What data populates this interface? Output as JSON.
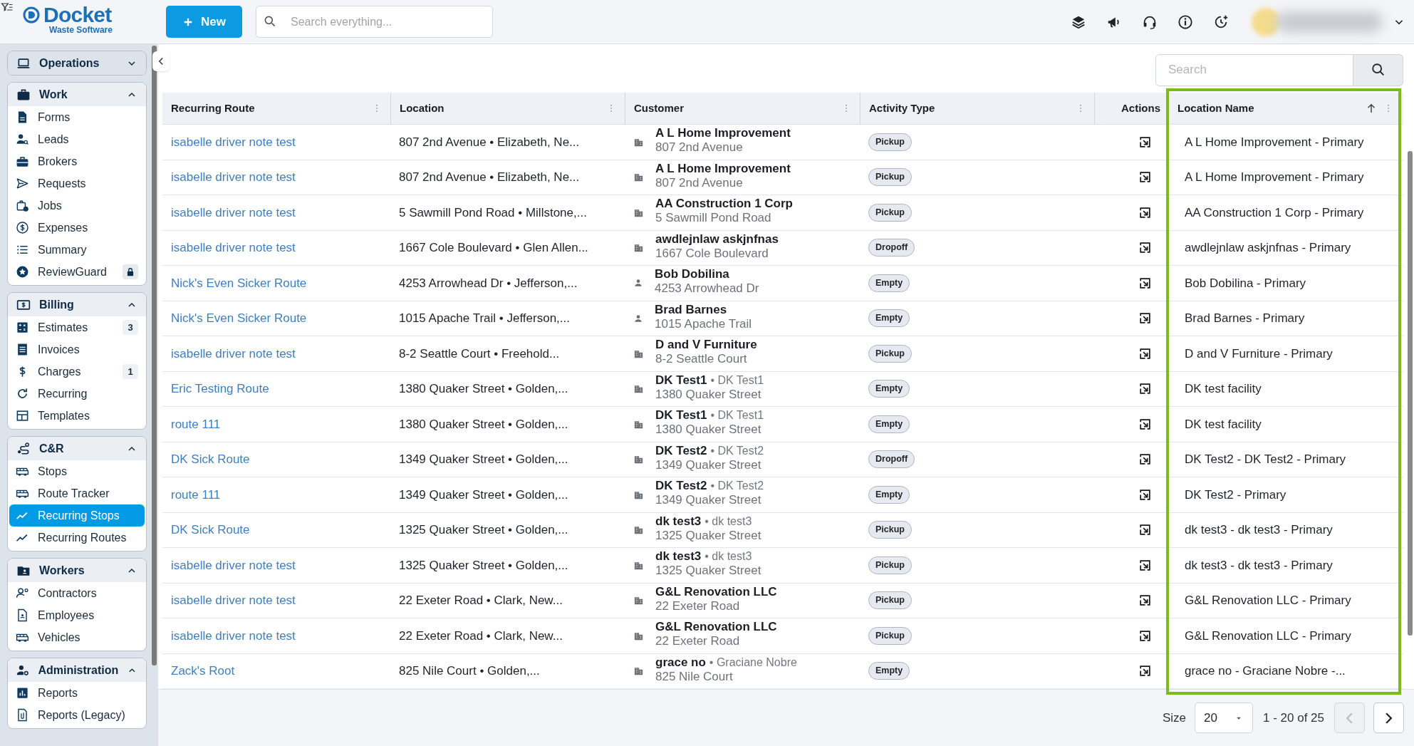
{
  "topbar": {
    "logo_name": "Docket",
    "logo_tagline": "Waste Software",
    "new_button": "New",
    "search": {
      "placeholder": "Search everything..."
    }
  },
  "sidebar": {
    "sections": [
      {
        "title": "Operations",
        "expanded": false
      },
      {
        "title": "Work",
        "expanded": true,
        "items": [
          {
            "label": "Forms",
            "selected": false,
            "locked": false
          },
          {
            "label": "Leads",
            "selected": false,
            "locked": false
          },
          {
            "label": "Brokers",
            "selected": false,
            "locked": false
          },
          {
            "label": "Requests",
            "selected": false,
            "locked": false
          },
          {
            "label": "Jobs",
            "selected": false,
            "locked": false
          },
          {
            "label": "Expenses",
            "selected": false,
            "locked": false
          },
          {
            "label": "Summary",
            "selected": false,
            "locked": false
          },
          {
            "label": "ReviewGuard",
            "selected": false,
            "locked": true
          }
        ]
      },
      {
        "title": "Billing",
        "expanded": true,
        "items": [
          {
            "label": "Estimates",
            "selected": false,
            "badge": "3"
          },
          {
            "label": "Invoices",
            "selected": false
          },
          {
            "label": "Charges",
            "selected": false,
            "badge": "1"
          },
          {
            "label": "Recurring",
            "selected": false
          },
          {
            "label": "Templates",
            "selected": false
          }
        ]
      },
      {
        "title": "C&R",
        "expanded": true,
        "items": [
          {
            "label": "Stops",
            "selected": false
          },
          {
            "label": "Route Tracker",
            "selected": false
          },
          {
            "label": "Recurring Stops",
            "selected": true
          },
          {
            "label": "Recurring Routes",
            "selected": false
          }
        ]
      },
      {
        "title": "Workers",
        "expanded": true,
        "items": [
          {
            "label": "Contractors",
            "selected": false
          },
          {
            "label": "Employees",
            "selected": false
          },
          {
            "label": "Vehicles",
            "selected": false
          }
        ]
      },
      {
        "title": "Administration",
        "expanded": true,
        "items": [
          {
            "label": "Reports",
            "selected": false
          },
          {
            "label": "Reports (Legacy)",
            "selected": false
          }
        ]
      }
    ]
  },
  "table_search": {
    "placeholder": "Search"
  },
  "table": {
    "columns": [
      {
        "label": "Recurring Route",
        "sorted": false,
        "highlighted": false
      },
      {
        "label": "Location",
        "sorted": false,
        "highlighted": false
      },
      {
        "label": "Customer",
        "sorted": false,
        "highlighted": false
      },
      {
        "label": "Activity Type",
        "sorted": false,
        "highlighted": false
      },
      {
        "label": "Actions",
        "sorted": false,
        "highlighted": false
      },
      {
        "label": "Location Name",
        "sorted": true,
        "highlighted": true
      }
    ],
    "rows": [
      {
        "route": "isabelle driver note test",
        "location": "807 2nd Avenue • Elizabeth, Ne...",
        "kind": "business",
        "customer": "A L Home Improvement",
        "address": "807 2nd Avenue",
        "activity": "Pickup",
        "location_name": "A L Home Improvement - Primary"
      },
      {
        "route": "isabelle driver note test",
        "location": "807 2nd Avenue • Elizabeth, Ne...",
        "kind": "business",
        "customer": "A L Home Improvement",
        "address": "807 2nd Avenue",
        "activity": "Pickup",
        "location_name": "A L Home Improvement - Primary"
      },
      {
        "route": "isabelle driver note test",
        "location": "5 Sawmill Pond Road • Millstone,...",
        "kind": "business",
        "customer": "AA Construction 1 Corp",
        "address": "5 Sawmill Pond Road",
        "activity": "Pickup",
        "location_name": "AA Construction 1 Corp - Primary"
      },
      {
        "route": "isabelle driver note test",
        "location": "1667 Cole Boulevard • Glen Allen...",
        "kind": "business",
        "customer": "awdlejnlaw askjnfnas",
        "address": "1667 Cole Boulevard",
        "activity": "Dropoff",
        "location_name": "awdlejnlaw askjnfnas - Primary"
      },
      {
        "route": "Nick's Even Sicker Route",
        "location": "4253 Arrowhead Dr • Jefferson,...",
        "kind": "person",
        "customer": "Bob Dobilina",
        "address": "4253 Arrowhead Dr",
        "activity": "Empty",
        "location_name": "Bob Dobilina - Primary"
      },
      {
        "route": "Nick's Even Sicker Route",
        "location": "1015 Apache Trail • Jefferson,...",
        "kind": "person",
        "customer": "Brad Barnes",
        "address": "1015 Apache Trail",
        "activity": "Empty",
        "location_name": "Brad Barnes - Primary"
      },
      {
        "route": "isabelle driver note test",
        "location": "8-2 Seattle Court • Freehold...",
        "kind": "business",
        "customer": "D and V Furniture",
        "address": "8-2 Seattle Court",
        "activity": "Pickup",
        "location_name": "D and V Furniture - Primary"
      },
      {
        "route": "Eric Testing Route",
        "location": "1380 Quaker Street • Golden,...",
        "kind": "business",
        "customer": "DK Test1",
        "customer_alias": "• DK Test1",
        "address": "1380 Quaker Street",
        "activity": "Empty",
        "location_name": "DK test facility"
      },
      {
        "route": "route 111",
        "location": "1380 Quaker Street • Golden,...",
        "kind": "business",
        "customer": "DK Test1",
        "customer_alias": "• DK Test1",
        "address": "1380 Quaker Street",
        "activity": "Empty",
        "location_name": "DK test facility"
      },
      {
        "route": "DK Sick Route",
        "location": "1349 Quaker Street • Golden,...",
        "kind": "business",
        "customer": "DK Test2",
        "customer_alias": "• DK Test2",
        "address": "1349 Quaker Street",
        "activity": "Dropoff",
        "location_name": "DK Test2 - DK Test2 - Primary"
      },
      {
        "route": "route 111",
        "location": "1349 Quaker Street • Golden,...",
        "kind": "business",
        "customer": "DK Test2",
        "customer_alias": "• DK Test2",
        "address": "1349 Quaker Street",
        "activity": "Empty",
        "location_name": "DK Test2 - Primary"
      },
      {
        "route": "DK Sick Route",
        "location": "1325 Quaker Street • Golden,...",
        "kind": "business",
        "customer": "dk test3",
        "customer_alias": "• dk test3",
        "address": "1325 Quaker Street",
        "activity": "Pickup",
        "location_name": "dk test3 - dk test3 - Primary"
      },
      {
        "route": "isabelle driver note test",
        "location": "1325 Quaker Street • Golden,...",
        "kind": "business",
        "customer": "dk test3",
        "customer_alias": "• dk test3",
        "address": "1325 Quaker Street",
        "activity": "Pickup",
        "location_name": "dk test3 - dk test3 - Primary"
      },
      {
        "route": "isabelle driver note test",
        "location": "22 Exeter Road • Clark, New...",
        "kind": "business",
        "customer": "G&L Renovation LLC",
        "address": "22 Exeter Road",
        "activity": "Pickup",
        "location_name": "G&L Renovation LLC - Primary"
      },
      {
        "route": "isabelle driver note test",
        "location": "22 Exeter Road • Clark, New...",
        "kind": "business",
        "customer": "G&L Renovation LLC",
        "address": "22 Exeter Road",
        "activity": "Pickup",
        "location_name": "G&L Renovation LLC - Primary"
      },
      {
        "route": "Zack's Root",
        "location": "825 Nile Court • Golden,...",
        "kind": "business",
        "customer": "grace no",
        "customer_alias": "• Graciane Nobre",
        "address": "825 Nile Court",
        "activity": "Empty",
        "location_name": "grace no - Graciane Nobre -..."
      }
    ]
  },
  "pagination": {
    "size_label": "Size",
    "size": "20",
    "range": "1 - 20 of 25",
    "prev_disabled": true,
    "next_disabled": false
  }
}
